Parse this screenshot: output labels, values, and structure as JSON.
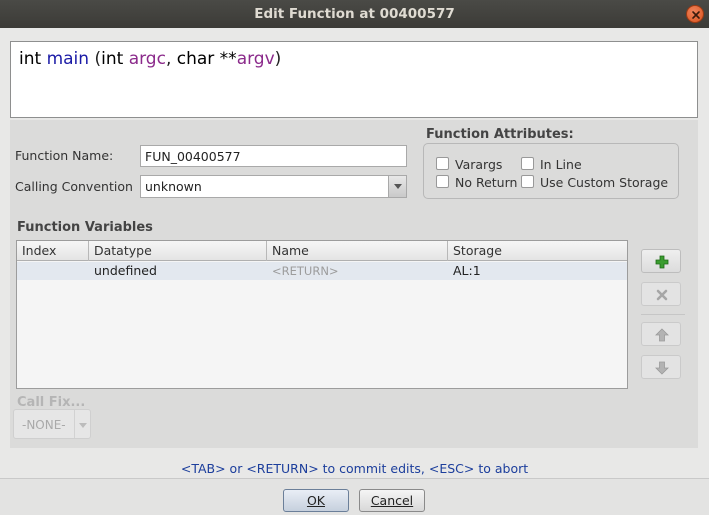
{
  "window": {
    "title": "Edit Function at 00400577"
  },
  "signature": {
    "return_type": "int",
    "name": "main",
    "open": " (",
    "p1_type": "int ",
    "p1_name": "argc",
    "comma": ", ",
    "p2_type": "char **",
    "p2_name": "argv",
    "close": ")"
  },
  "form": {
    "function_name_label": "Function Name:",
    "function_name_value": "FUN_00400577",
    "calling_convention_label": "Calling Convention",
    "calling_convention_value": "unknown"
  },
  "attributes": {
    "heading": "Function Attributes:",
    "varargs": "Varargs",
    "in_line": "In Line",
    "no_return": "No Return",
    "custom_storage": "Use Custom Storage"
  },
  "variables": {
    "heading": "Function Variables",
    "columns": [
      "Index",
      "Datatype",
      "Name",
      "Storage"
    ],
    "rows": [
      {
        "index": "",
        "datatype": "undefined",
        "name": "<RETURN>",
        "storage": "AL:1"
      }
    ]
  },
  "call_fixup": {
    "label": "Call Fix...",
    "value": "-NONE-"
  },
  "hint": "<TAB> or <RETURN> to commit edits, <ESC> to abort",
  "buttons": {
    "ok": "OK",
    "cancel": "Cancel"
  },
  "icons": {
    "add": "plus-icon",
    "remove": "x-icon",
    "up": "arrow-up-icon",
    "down": "arrow-down-icon",
    "close": "close-icon"
  },
  "colors": {
    "accent_add": "#3a9d2f",
    "hint_text": "#1c3e9c",
    "param_name": "#8b2a8b",
    "function_name": "#1a1aa6"
  }
}
